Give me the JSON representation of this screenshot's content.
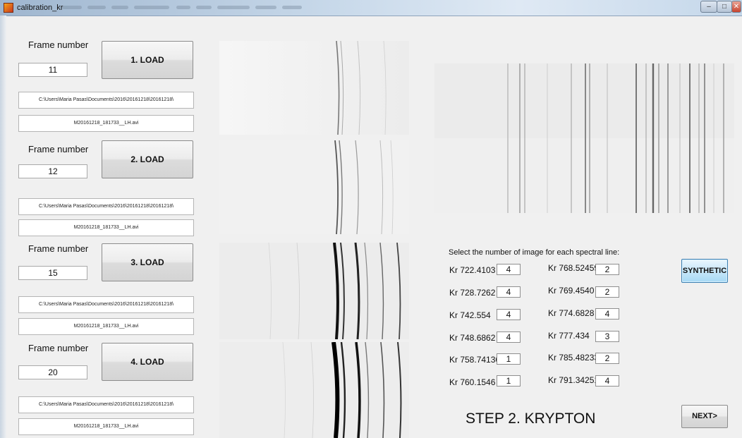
{
  "window": {
    "title": "calibration_kr",
    "minimize_glyph": "–",
    "maximize_glyph": "□",
    "close_glyph": "✕"
  },
  "loaders": [
    {
      "frame_label": "Frame number",
      "frame_value": "11",
      "load_label": "1. LOAD",
      "folder": "C:\\Users\\Maria Pasas\\Documents\\2016\\20161218\\20161218\\",
      "file": "M20161218_181733__LH.avi"
    },
    {
      "frame_label": "Frame number",
      "frame_value": "12",
      "load_label": "2. LOAD",
      "folder": "C:\\Users\\Maria Pasas\\Documents\\2016\\20161218\\20161218\\",
      "file": "M20161218_181733__LH.avi"
    },
    {
      "frame_label": "Frame number",
      "frame_value": "15",
      "load_label": "3. LOAD",
      "folder": "C:\\Users\\Maria Pasas\\Documents\\2016\\20161218\\20161218\\",
      "file": "M20161218_181733__LH.avi"
    },
    {
      "frame_label": "Frame number",
      "frame_value": "20",
      "load_label": "4. LOAD",
      "folder": "C:\\Users\\Maria Pasas\\Documents\\2016\\20161218\\20161218\\",
      "file": "M20161218_181733__LH.avi"
    }
  ],
  "selection": {
    "title": "Select the number of image for each spectral line:",
    "left_column": [
      {
        "label": "Kr 722.4103",
        "value": "4"
      },
      {
        "label": "Kr 728.7262",
        "value": "4"
      },
      {
        "label": "Kr 742.554",
        "value": "4"
      },
      {
        "label": "Kr 748.6862",
        "value": "4"
      },
      {
        "label": "Kr 758.74136",
        "value": "1"
      },
      {
        "label": "Kr 760.1546",
        "value": "1"
      }
    ],
    "right_column": [
      {
        "label": "Kr 768.52459",
        "value": "2"
      },
      {
        "label": "Kr 769.4540",
        "value": "2"
      },
      {
        "label": "Kr 774.6828",
        "value": "4"
      },
      {
        "label": "Kr 777.434",
        "value": "3"
      },
      {
        "label": "Kr 785.48233",
        "value": "2"
      },
      {
        "label": "Kr 791.34251",
        "value": "4"
      }
    ]
  },
  "buttons": {
    "synthetic": "SYNTHETIC",
    "next": "NEXT>"
  },
  "step_title": "STEP 2. KRYPTON",
  "colors": {
    "background": "#f0f0f0",
    "synthetic_button": "#a7d9f5"
  }
}
